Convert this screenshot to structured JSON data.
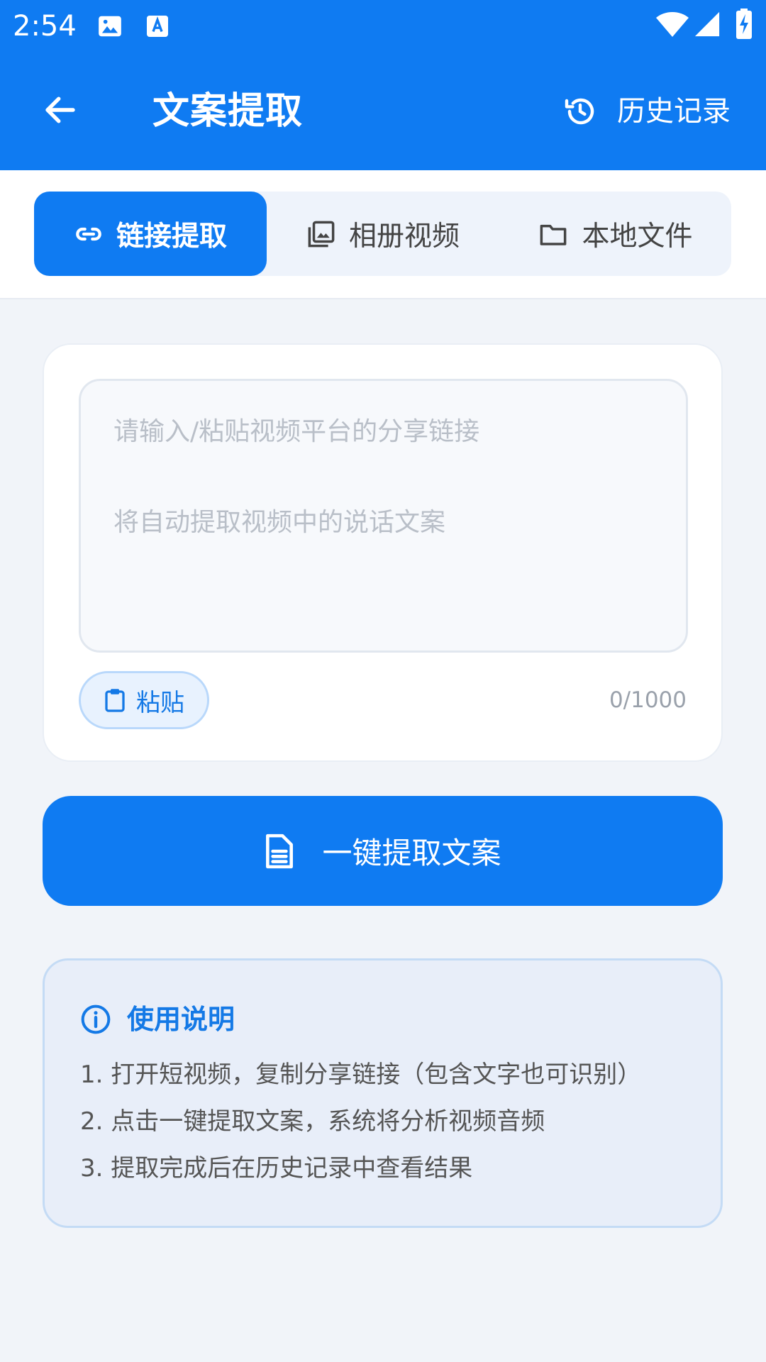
{
  "status_bar": {
    "time": "2:54",
    "icons": [
      "image-icon",
      "keyboard-a-icon",
      "wifi-icon",
      "signal-icon",
      "battery-charging-icon"
    ]
  },
  "app_bar": {
    "title": "文案提取",
    "back_icon": "arrow-left-icon",
    "history": {
      "label": "历史记录",
      "icon": "history-icon"
    }
  },
  "tabs": [
    {
      "label": "链接提取",
      "icon": "link-icon",
      "selected": true
    },
    {
      "label": "相册视频",
      "icon": "photo-library-icon",
      "selected": false
    },
    {
      "label": "本地文件",
      "icon": "folder-icon",
      "selected": false
    }
  ],
  "input": {
    "value": "",
    "placeholder": "请输入/粘贴视频平台的分享链接\n\n将自动提取视频中的说话文案",
    "paste_label": "粘贴",
    "paste_icon": "clipboard-icon",
    "char_count": "0/1000"
  },
  "extract_button": {
    "label": "一键提取文案",
    "icon": "document-icon"
  },
  "instructions": {
    "title": "使用说明",
    "icon": "info-icon",
    "steps": [
      "1. 打开短视频，复制分享链接（包含文字也可识别）",
      "2. 点击一键提取文案，系统将分析视频音频",
      "3. 提取完成后在历史记录中查看结果"
    ]
  },
  "colors": {
    "primary": "#0f7bf2",
    "background": "#f1f4f9",
    "tab_group_bg": "#eef3fb",
    "help_card_bg": "#e8eef9",
    "help_title": "#1479e6"
  }
}
